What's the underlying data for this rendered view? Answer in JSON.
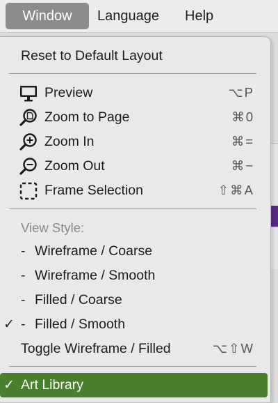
{
  "menubar": {
    "items": [
      {
        "label": "Window",
        "active": true
      },
      {
        "label": "Language",
        "active": false
      },
      {
        "label": "Help",
        "active": false
      }
    ]
  },
  "menu": {
    "reset": {
      "label": "Reset to Default Layout"
    },
    "preview": {
      "label": "Preview",
      "shortcut": "⌥P",
      "icon": "monitor-icon"
    },
    "zoom_to_page": {
      "label": "Zoom to Page",
      "shortcut": "⌘0",
      "icon": "zoom-page-icon"
    },
    "zoom_in": {
      "label": "Zoom In",
      "shortcut": "⌘=",
      "icon": "zoom-in-icon"
    },
    "zoom_out": {
      "label": "Zoom Out",
      "shortcut": "⌘−",
      "icon": "zoom-out-icon"
    },
    "frame_selection": {
      "label": "Frame Selection",
      "shortcut": "⇧⌘A",
      "icon": "dashed-frame-icon"
    },
    "view_style_header": "View Style:",
    "view_styles": [
      {
        "dash": "-",
        "label": "Wireframe / Coarse",
        "checked": false
      },
      {
        "dash": "-",
        "label": "Wireframe / Smooth",
        "checked": false
      },
      {
        "dash": "-",
        "label": "Filled / Coarse",
        "checked": false
      },
      {
        "dash": "-",
        "label": "Filled / Smooth",
        "checked": true
      }
    ],
    "toggle_wireframe": {
      "label": "Toggle Wireframe / Filled",
      "shortcut": "⌥⇧W"
    },
    "art_library": {
      "label": "Art Library",
      "checked": true,
      "highlighted": true
    },
    "check_mark": "✓"
  },
  "colors": {
    "highlight": "#4a7f2d",
    "active_menu": "#8c8c8c"
  }
}
